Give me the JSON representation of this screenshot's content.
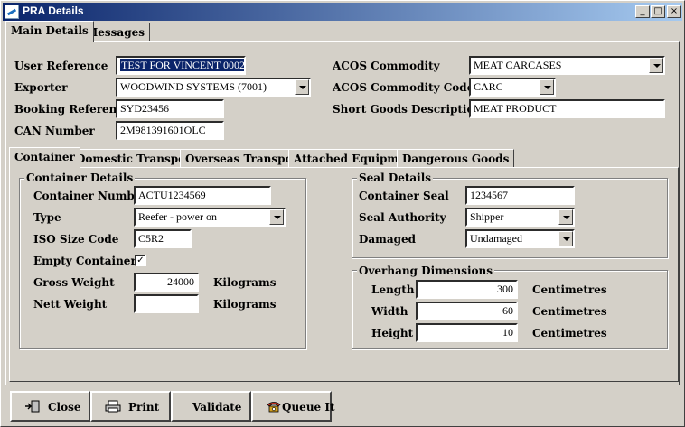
{
  "window": {
    "title": "PRA Details"
  },
  "title_buttons": {
    "minimize": "_",
    "maximize": "□",
    "close": "×"
  },
  "main_tabs": [
    "Main Details",
    "Messages"
  ],
  "main": {
    "user_reference_label": "User Reference",
    "user_reference_value": "TEST FOR VINCENT 0002",
    "exporter_label": "Exporter",
    "exporter_value": "WOODWIND SYSTEMS (7001)",
    "booking_reference_label": "Booking Reference",
    "booking_reference_value": "SYD23456",
    "can_number_label": "CAN Number",
    "can_number_value": "2M981391601OLC",
    "acos_commodity_label": "ACOS Commodity",
    "acos_commodity_value": "MEAT CARCASES",
    "acos_commodity_code_label": "ACOS Commodity Code",
    "acos_commodity_code_value": "CARC",
    "short_goods_label": "Short Goods Description",
    "short_goods_value": "MEAT PRODUCT"
  },
  "sub_tabs": [
    "Container",
    "Domestic Transport",
    "Overseas Transport",
    "Attached Equipment",
    "Dangerous Goods"
  ],
  "container_details": {
    "title": "Container Details",
    "container_number_label": "Container Number",
    "container_number_value": "ACTU1234569",
    "type_label": "Type",
    "type_value": "Reefer - power on",
    "iso_size_label": "ISO Size Code",
    "iso_size_value": "C5R2",
    "empty_label": "Empty Container",
    "empty_checked": "✓",
    "gross_weight_label": "Gross Weight",
    "gross_weight_value": "24000",
    "gross_weight_unit": "Kilograms",
    "nett_weight_label": "Nett Weight",
    "nett_weight_value": "",
    "nett_weight_unit": "Kilograms"
  },
  "seal_details": {
    "title": "Seal Details",
    "container_seal_label": "Container Seal",
    "container_seal_value": "1234567",
    "seal_authority_label": "Seal Authority",
    "seal_authority_value": "Shipper",
    "damaged_label": "Damaged",
    "damaged_value": "Undamaged"
  },
  "overhang": {
    "title": "Overhang Dimensions",
    "length_label": "Length",
    "length_value": "300",
    "width_label": "Width",
    "width_value": "60",
    "height_label": "Height",
    "height_value": "10",
    "unit": "Centimetres"
  },
  "buttons": {
    "close": "Close",
    "print": "Print",
    "validate": "Validate",
    "queue": "Queue It"
  }
}
